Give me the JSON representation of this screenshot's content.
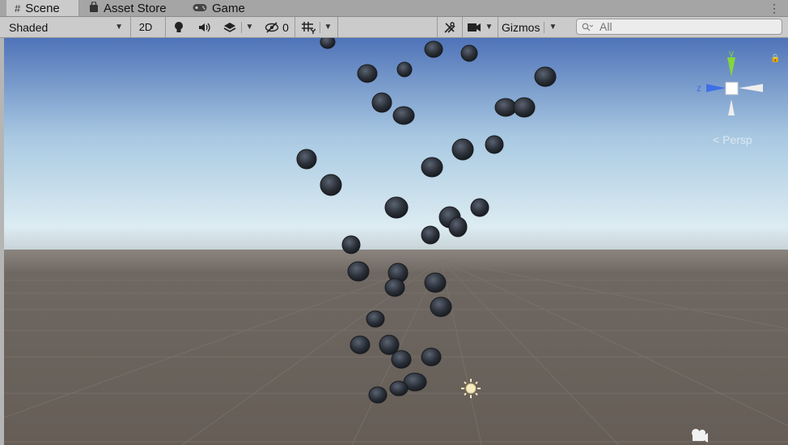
{
  "tabs": [
    {
      "label": "Scene",
      "icon": "grid-hash-icon"
    },
    {
      "label": "Asset Store",
      "icon": "shopping-bag-icon"
    },
    {
      "label": "Game",
      "icon": "gamepad-icon"
    }
  ],
  "toolbar": {
    "shading_mode": "Shaded",
    "mode_2d": "2D",
    "hidden_count": "0",
    "gizmos": "Gizmos",
    "search_placeholder": "All"
  },
  "gizmo": {
    "y_label": "y",
    "z_label": "z",
    "projection_label": "Persp"
  },
  "colors": {
    "sky_top": "#4f73b8",
    "sky_horizon": "#dcecf2",
    "ground": "#6a625b",
    "toolbar": "#cbcbcb",
    "tabbar": "#a5a5a5"
  }
}
